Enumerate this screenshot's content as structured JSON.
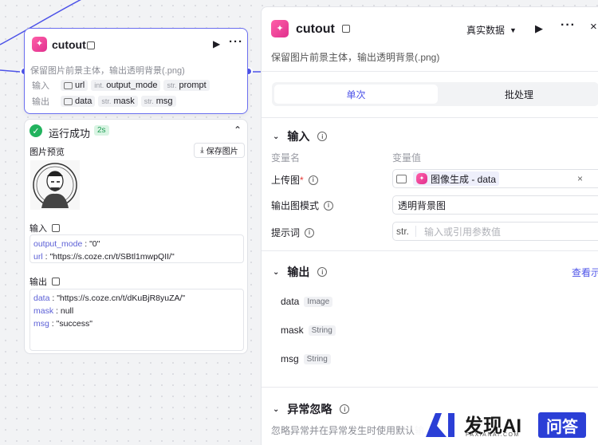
{
  "node": {
    "title": "cutout",
    "description": "保留图片前景主体，输出透明背景(.png)",
    "input_label": "输入",
    "inputs": [
      {
        "type": "",
        "name": "url",
        "icon": "image-icon"
      },
      {
        "type": "int.",
        "name": "output_mode"
      },
      {
        "type": "str.",
        "name": "prompt"
      }
    ],
    "output_label": "输出",
    "outputs": [
      {
        "type": "",
        "name": "data",
        "icon": "image-icon"
      },
      {
        "type": "str.",
        "name": "mask"
      },
      {
        "type": "str.",
        "name": "msg"
      }
    ]
  },
  "result": {
    "status": "运行成功",
    "duration": "2s",
    "preview_label": "图片预览",
    "save_button": "保存图片",
    "input_label": "输入",
    "input_lines": [
      {
        "key": "output_mode",
        "value": "\"0\""
      },
      {
        "key": "url",
        "value": "\"https://s.coze.cn/t/SBtl1mwpQII/\""
      }
    ],
    "output_label": "输出",
    "output_lines": [
      {
        "key": "data",
        "value": "\"https://s.coze.cn/t/dKuBjR8yuZA/\""
      },
      {
        "key": "mask",
        "value": "null"
      },
      {
        "key": "msg",
        "value": "\"success\""
      }
    ]
  },
  "panel": {
    "title": "cutout",
    "data_mode": "真实数据",
    "description": "保留图片前景主体，输出透明背景(.png)",
    "tabs": [
      "单次",
      "批处理"
    ],
    "input_section": "输入",
    "col_name": "变量名",
    "col_value": "变量值",
    "rows": [
      {
        "label": "上传图",
        "required": "*",
        "chip_text": "图像生成 - data",
        "close": "×"
      },
      {
        "label": "输出图模式",
        "value": "透明背景图"
      },
      {
        "label": "提示词",
        "type": "str.",
        "placeholder": "输入或引用参数值"
      }
    ],
    "output_section": "输出",
    "view_link": "查看示",
    "outputs": [
      {
        "name": "data",
        "type": "Image"
      },
      {
        "name": "mask",
        "type": "String"
      },
      {
        "name": "msg",
        "type": "String"
      }
    ],
    "exception_section": "异常忽略",
    "exception_desc": "忽略异常并在异常发生时使用默认输"
  },
  "watermark": {
    "brand": "发现AI",
    "sub": "FAXIANAI.COM",
    "badge": "问答"
  },
  "colors": {
    "accent": "#4d53e8",
    "success": "#22b35e",
    "icon_pink": "#e0308e"
  }
}
